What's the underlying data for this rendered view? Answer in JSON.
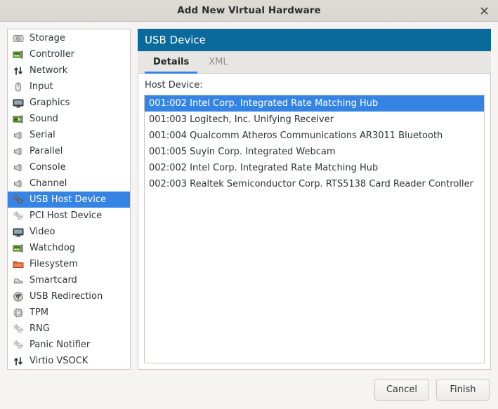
{
  "window": {
    "title": "Add New Virtual Hardware",
    "close_icon": "close-icon"
  },
  "sidebar": {
    "items": [
      {
        "label": "Storage",
        "icon": "hard-drive-icon"
      },
      {
        "label": "Controller",
        "icon": "controller-card-icon"
      },
      {
        "label": "Network",
        "icon": "network-arrows-icon"
      },
      {
        "label": "Input",
        "icon": "mouse-icon"
      },
      {
        "label": "Graphics",
        "icon": "monitor-icon"
      },
      {
        "label": "Sound",
        "icon": "sound-card-icon"
      },
      {
        "label": "Serial",
        "icon": "serial-port-icon"
      },
      {
        "label": "Parallel",
        "icon": "parallel-port-icon"
      },
      {
        "label": "Console",
        "icon": "console-port-icon"
      },
      {
        "label": "Channel",
        "icon": "channel-port-icon"
      },
      {
        "label": "USB Host Device",
        "icon": "usb-host-gears-icon",
        "selected": true
      },
      {
        "label": "PCI Host Device",
        "icon": "pci-host-gears-icon"
      },
      {
        "label": "Video",
        "icon": "monitor-icon"
      },
      {
        "label": "Watchdog",
        "icon": "watchdog-card-icon"
      },
      {
        "label": "Filesystem",
        "icon": "folder-icon"
      },
      {
        "label": "Smartcard",
        "icon": "smartcard-reader-icon"
      },
      {
        "label": "USB Redirection",
        "icon": "usb-symbol-icon"
      },
      {
        "label": "TPM",
        "icon": "chip-icon"
      },
      {
        "label": "RNG",
        "icon": "gears-icon"
      },
      {
        "label": "Panic Notifier",
        "icon": "gears-icon"
      },
      {
        "label": "Virtio VSOCK",
        "icon": "network-arrows-icon"
      }
    ]
  },
  "main": {
    "header_title": "USB Device",
    "tabs": [
      {
        "label": "Details",
        "active": true
      },
      {
        "label": "XML",
        "active": false
      }
    ],
    "host_device_label": "Host Device:",
    "devices": [
      {
        "text": "001:002 Intel Corp. Integrated Rate Matching Hub",
        "selected": true
      },
      {
        "text": "001:003 Logitech, Inc. Unifying Receiver",
        "selected": false
      },
      {
        "text": "001:004 Qualcomm Atheros Communications AR3011 Bluetooth",
        "selected": false
      },
      {
        "text": "001:005 Suyin Corp. Integrated Webcam",
        "selected": false
      },
      {
        "text": "002:002 Intel Corp. Integrated Rate Matching Hub",
        "selected": false
      },
      {
        "text": "002:003 Realtek Semiconductor Corp. RTS5138 Card Reader Controller",
        "selected": false
      }
    ]
  },
  "footer": {
    "cancel_label": "Cancel",
    "finish_label": "Finish"
  },
  "colors": {
    "header_blue": "#0b6a9c",
    "selection_blue": "#3584e4",
    "window_bg": "#f5f4f2",
    "titlebar_bg": "#dedad5",
    "border": "#cdc7c2"
  }
}
